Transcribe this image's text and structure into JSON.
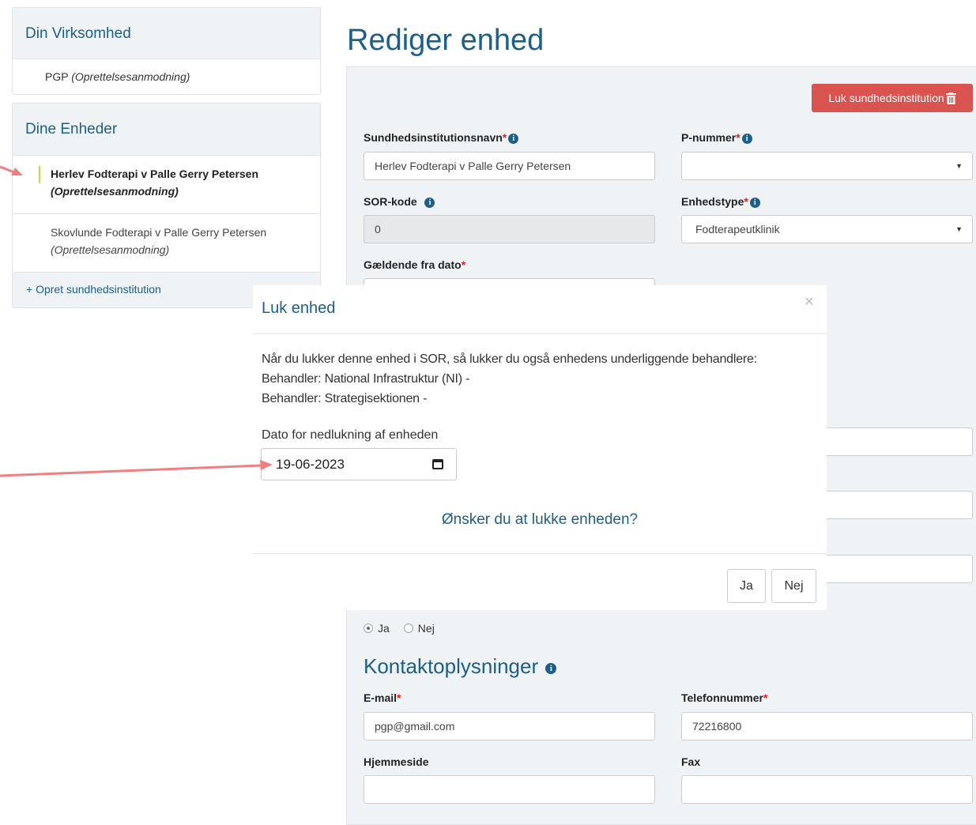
{
  "sidebar": {
    "company": {
      "heading": "Din Virksomhed",
      "item_name": "PGP",
      "item_status": "(Oprettelsesanmodning)"
    },
    "units": {
      "heading": "Dine Enheder",
      "items": [
        {
          "name": "Herlev Fodterapi v Palle Gerry Petersen",
          "status": "(Oprettelsesanmodning)"
        },
        {
          "name": "Skovlunde Fodterapi v Palle Gerry Petersen",
          "status": "(Oprettelsesanmodning)"
        }
      ]
    },
    "create_link": "+ Opret sundhedsinstitution"
  },
  "main": {
    "title": "Rediger enhed",
    "close_institution_button": "Luk sundhedsinstitution",
    "fields": {
      "institution_name": {
        "label": "Sundhedsinstitutionsnavn",
        "value": "Herlev Fodterapi v Palle Gerry Petersen"
      },
      "p_number": {
        "label": "P-nummer",
        "value": ""
      },
      "sor_code": {
        "label": "SOR-kode",
        "value": "0"
      },
      "unit_type": {
        "label": "Enhedstype",
        "value": "Fodterapeutklinik"
      },
      "valid_from": {
        "label": "Gældende fra dato"
      }
    },
    "radio": {
      "yes": "Ja",
      "no": "Nej",
      "selected": "Ja"
    },
    "contact": {
      "title": "Kontaktoplysninger",
      "email": {
        "label": "E-mail",
        "value": "pgp@gmail.com"
      },
      "phone": {
        "label": "Telefonnummer",
        "value": "72216800"
      },
      "website": {
        "label": "Hjemmeside",
        "value": ""
      },
      "fax": {
        "label": "Fax",
        "value": ""
      }
    }
  },
  "modal": {
    "title": "Luk enhed",
    "close_symbol": "×",
    "body_lines": [
      "Når du lukker denne enhed i SOR, så lukker du også enhedens underliggende behandlere:",
      "Behandler: National Infrastruktur (NI) -",
      "Behandler: Strategisektionen -"
    ],
    "date_label": "Dato for nedlukning af enheden",
    "date_value": "19-06-2023",
    "question": "Ønsker du at lukke enheden?",
    "yes_button": "Ja",
    "no_button": "Nej"
  },
  "colors": {
    "brand_blue": "#1c5f8a",
    "danger": "#d9534f",
    "required": "#d9231b",
    "annotation_arrow": "#f08080",
    "active_marker": "#c7dc3a"
  },
  "icons": [
    "info-icon",
    "trash-icon",
    "calendar-icon",
    "caret-down-icon",
    "close-icon",
    "arrow-annotation"
  ]
}
